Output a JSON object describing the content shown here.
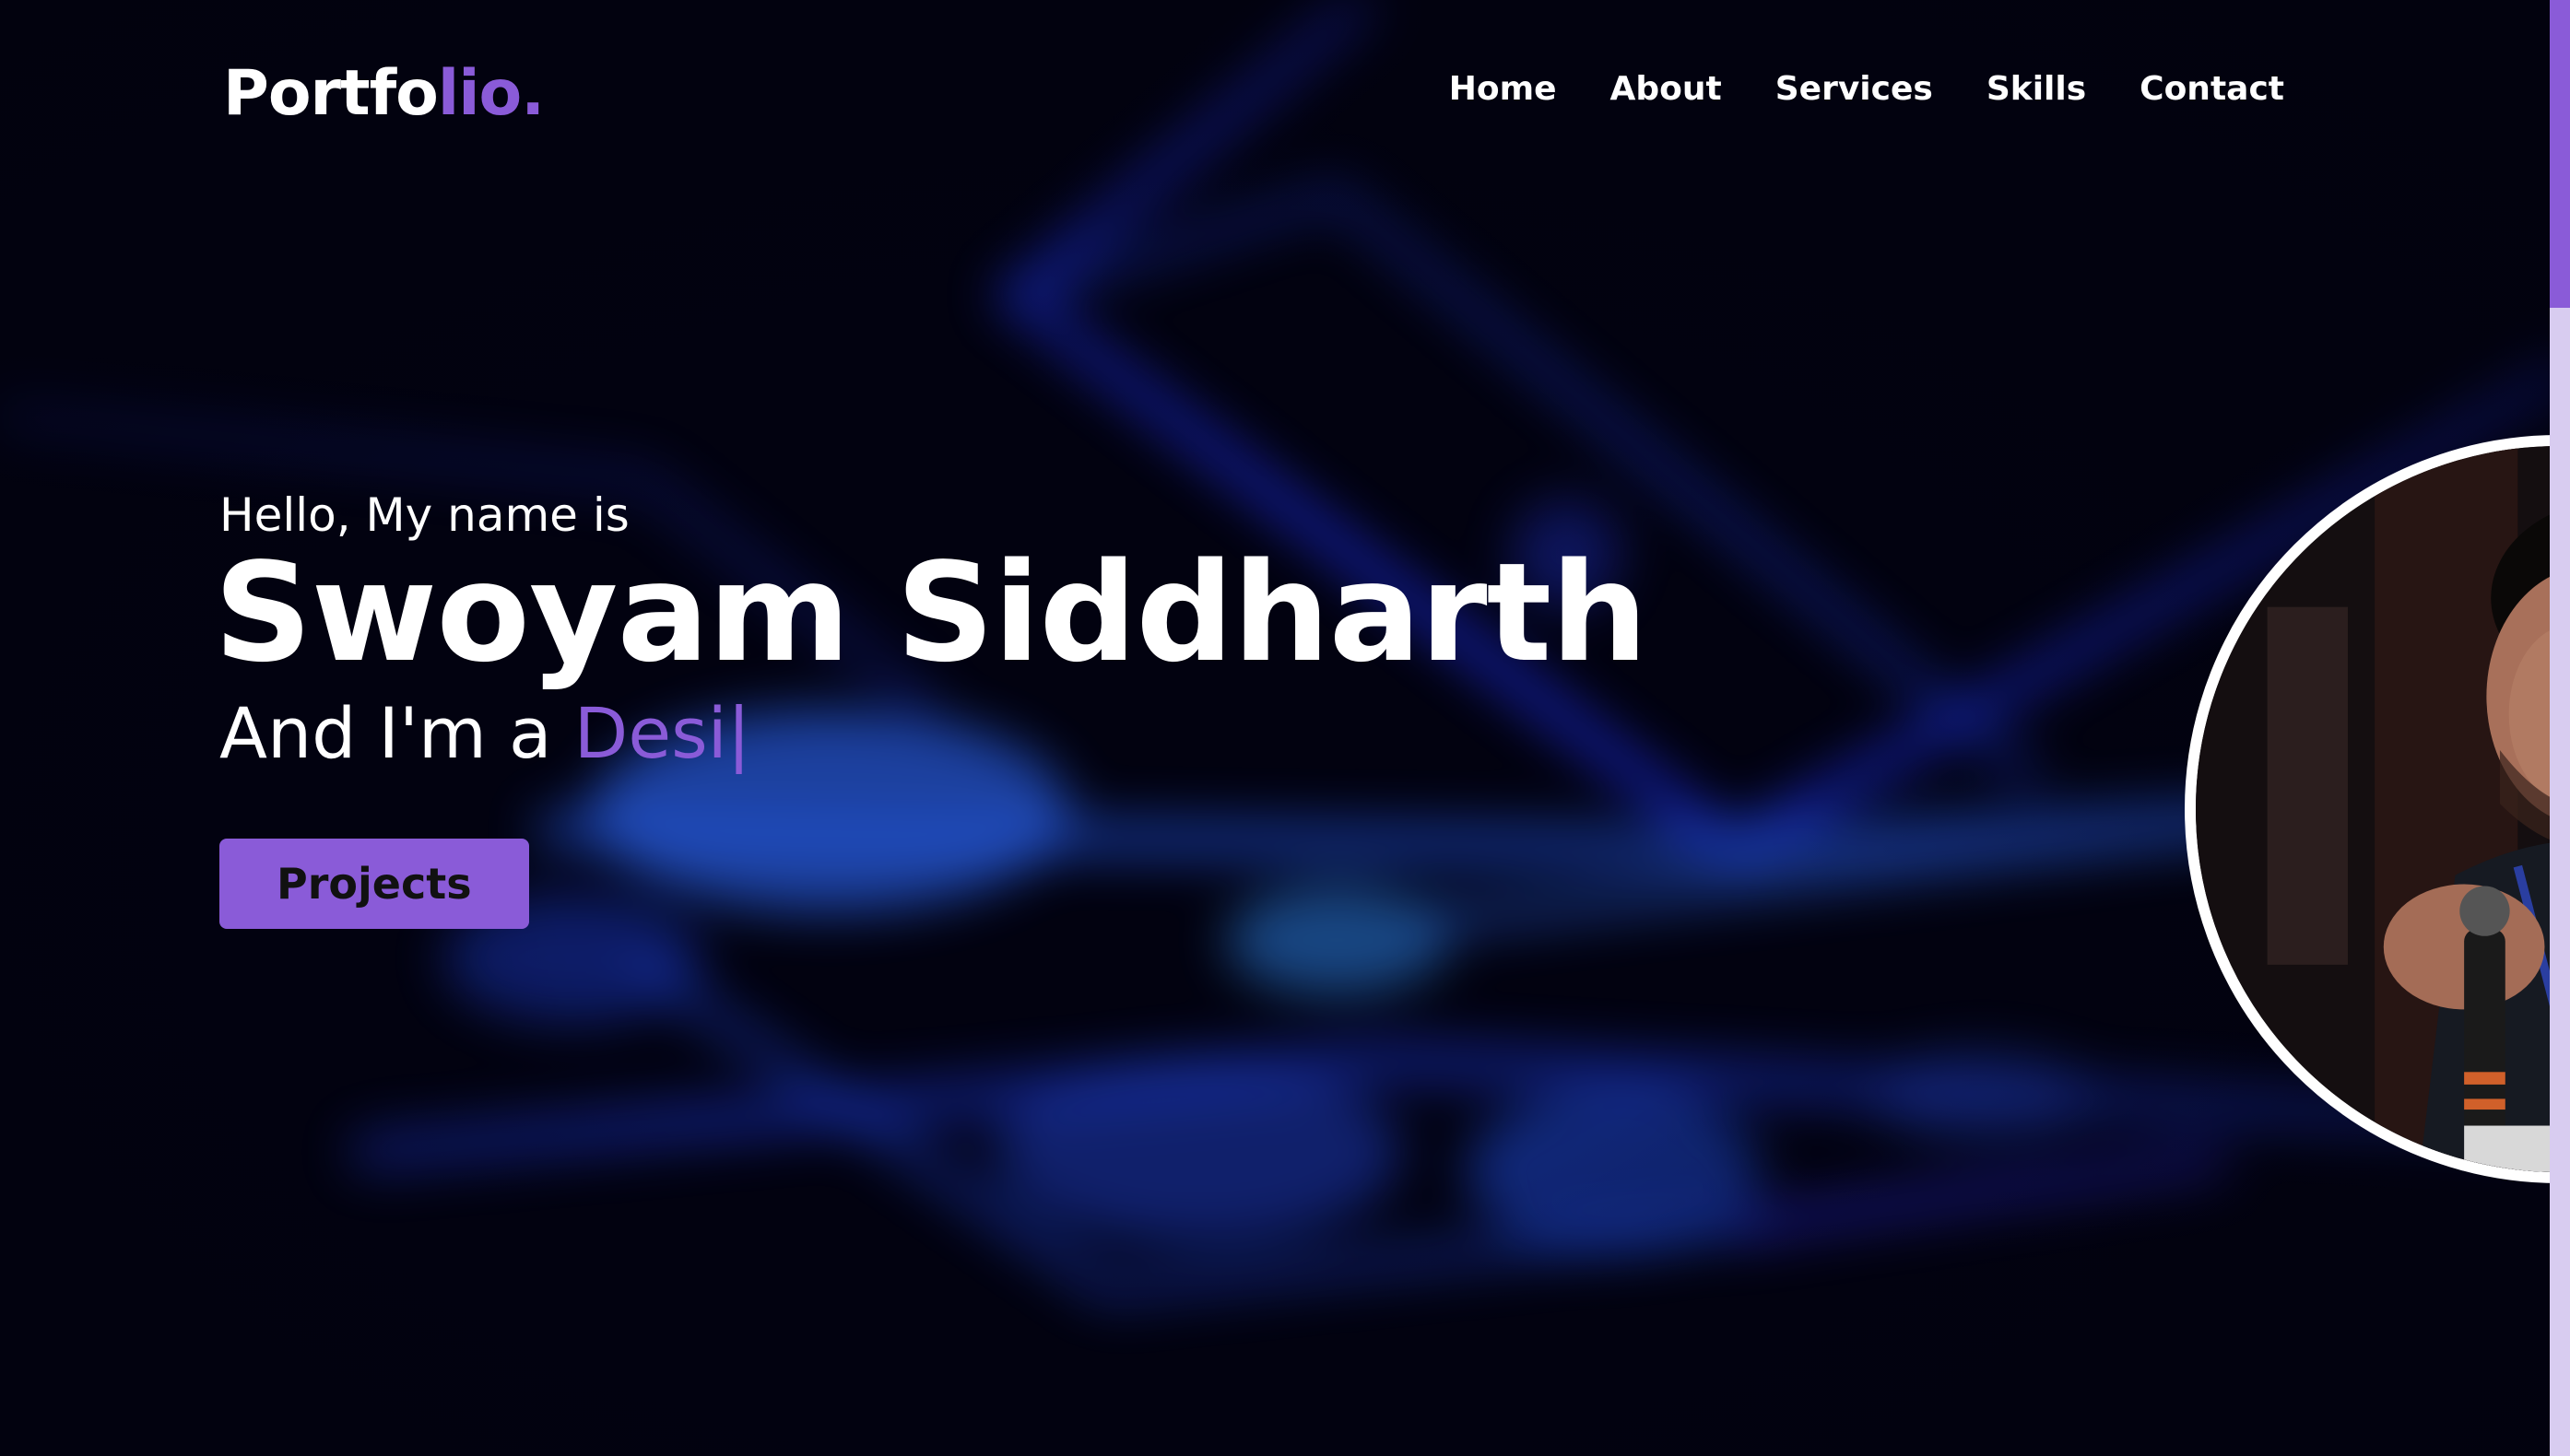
{
  "brand": {
    "logo_main": "Portfo",
    "logo_accent": "lio.",
    "accent_color": "#8a5bd8"
  },
  "nav": {
    "items": [
      "Home",
      "About",
      "Services",
      "Skills",
      "Contact"
    ]
  },
  "hero": {
    "greeting": "Hello, My name is",
    "name": "Swoyam Siddharth",
    "role_prefix": "And I'm a ",
    "role_typed": "Desi",
    "cursor": "|",
    "button_label": "Projects"
  },
  "avatar": {
    "icon": "profile-photo"
  }
}
